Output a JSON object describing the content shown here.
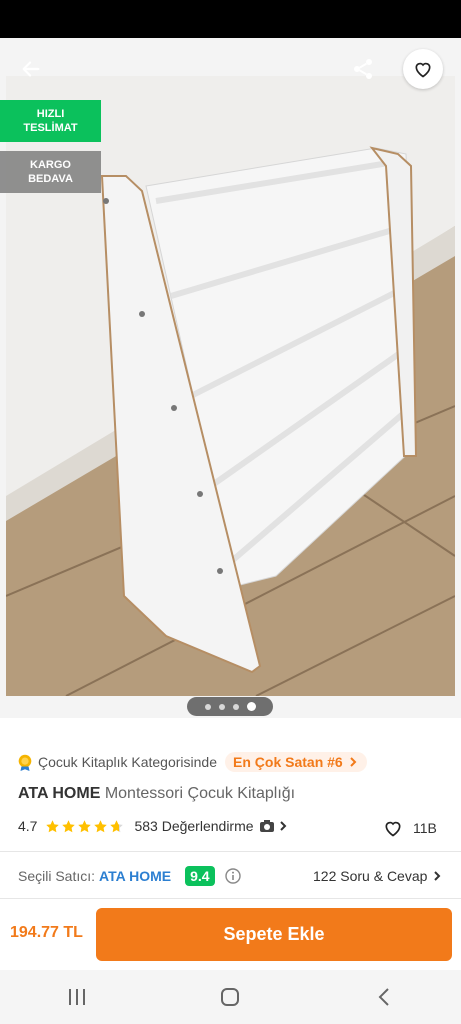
{
  "badges": {
    "fast_delivery": [
      "HIZLI",
      "TESLİMAT"
    ],
    "free_cargo": [
      "KARGO",
      "BEDAVA"
    ]
  },
  "gallery": {
    "total": 4,
    "active_index": 3
  },
  "category": {
    "text": "Çocuk Kitaplık Kategorisinde",
    "bestseller": "En Çok Satan #6"
  },
  "product": {
    "brand": "ATA HOME",
    "name": "Montessori Çocuk Kitaplığı",
    "rating": "4.7",
    "rating_value": 4.7,
    "reviews": "583 Değerlendirme",
    "likes": "11B"
  },
  "seller": {
    "label": "Seçili Satıcı:",
    "name": "ATA HOME",
    "score": "9.4",
    "qa": "122 Soru & Cevap"
  },
  "purchase": {
    "price": "194.77 TL",
    "cta": "Sepete Ekle"
  },
  "colors": {
    "accent": "#f27a1a",
    "green": "#0bc15c",
    "link": "#2c7fd1"
  },
  "icons": [
    "back-arrow-icon",
    "share-icon",
    "heart-icon",
    "medal-icon",
    "star-icon",
    "camera-icon",
    "chevron-right-icon",
    "info-icon",
    "recent-apps-icon",
    "home-icon",
    "back-icon"
  ]
}
